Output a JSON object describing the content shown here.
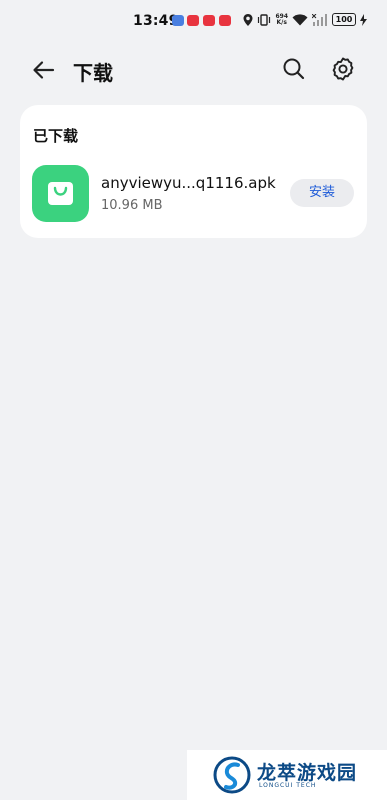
{
  "status_bar": {
    "time": "13:49",
    "net_speed_value": "694",
    "net_speed_unit": "K/s",
    "battery": "100"
  },
  "header": {
    "title": "下载"
  },
  "downloads": {
    "section_title": "已下载",
    "files": [
      {
        "name": "anyviewyu...q1116.apk",
        "size": "10.96 MB",
        "action_label": "安装"
      }
    ]
  },
  "watermark": {
    "text": "龙萃游戏园",
    "subtext": "LONGCUI TECH"
  },
  "colors": {
    "background": "#f1f2f4",
    "card": "#ffffff",
    "app_icon": "#3bd27f",
    "install_text": "#1e5bd8",
    "install_bg": "#ebecef"
  }
}
